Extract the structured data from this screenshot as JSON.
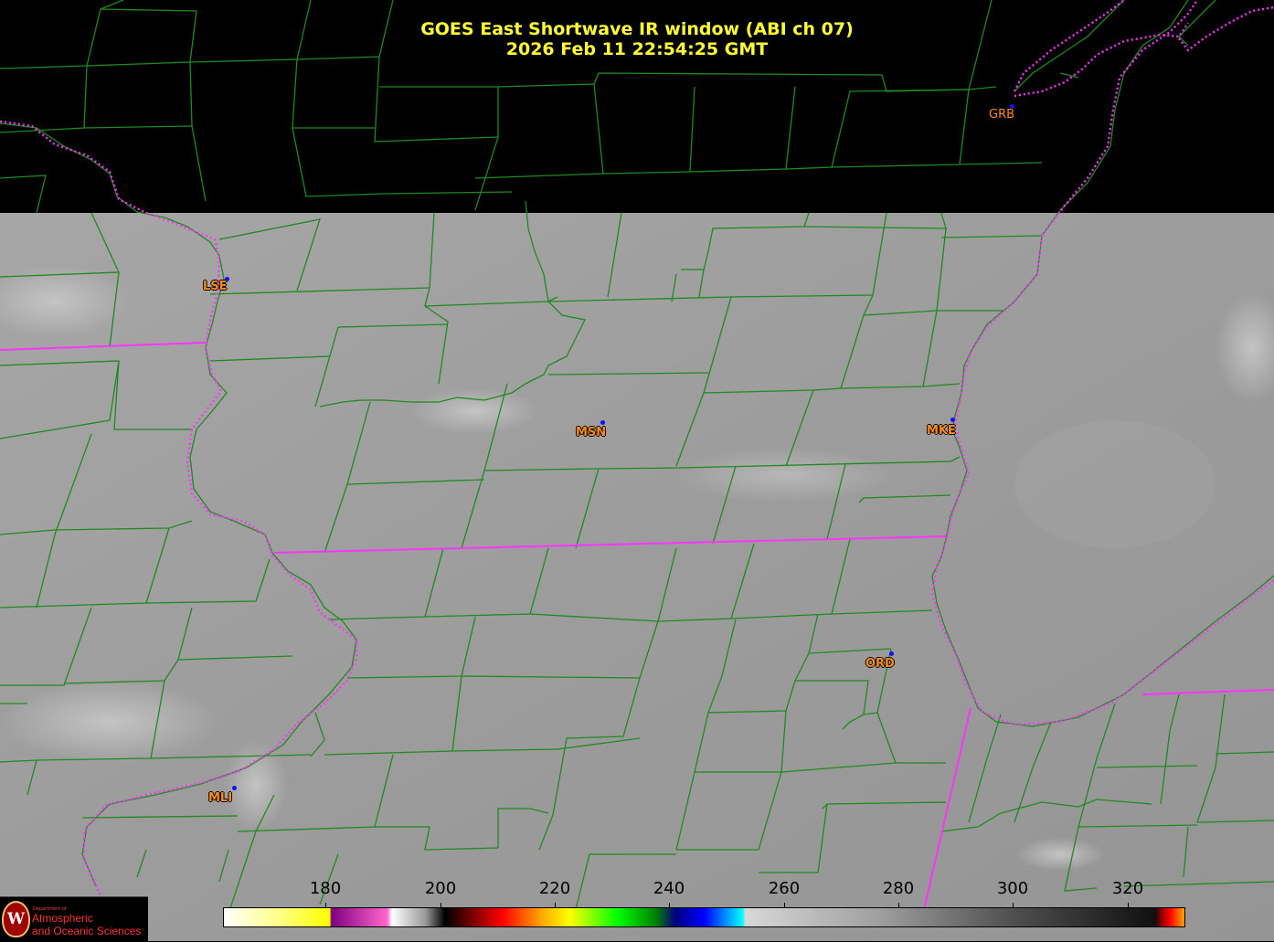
{
  "title": {
    "line1": "GOES East Shortwave IR window (ABI ch 07)",
    "line2": "2026 Feb 11  22:54:25 GMT"
  },
  "colors": {
    "title": "#ffff33",
    "county_lines": "#1f8a1f",
    "state_borders": "#ff33ff",
    "city_labels": "#ff8c1a",
    "station_dots": "#1010ff",
    "imagery_gray": "#9a9a9a"
  },
  "stations": [
    {
      "id": "GRB",
      "label": "GRB"
    },
    {
      "id": "LSE",
      "label": "LSE"
    },
    {
      "id": "MSN",
      "label": "MSN"
    },
    {
      "id": "MKE",
      "label": "MKE"
    },
    {
      "id": "ORD",
      "label": "ORD"
    },
    {
      "id": "MLI",
      "label": "MLI"
    }
  ],
  "colorbar": {
    "ticks": [
      "180",
      "200",
      "220",
      "240",
      "260",
      "280",
      "300",
      "320"
    ]
  },
  "logo": {
    "seal_letter": "W",
    "small_text": "Department of",
    "line1": "Atmospheric",
    "line2": "and Oceanic Sciences"
  }
}
